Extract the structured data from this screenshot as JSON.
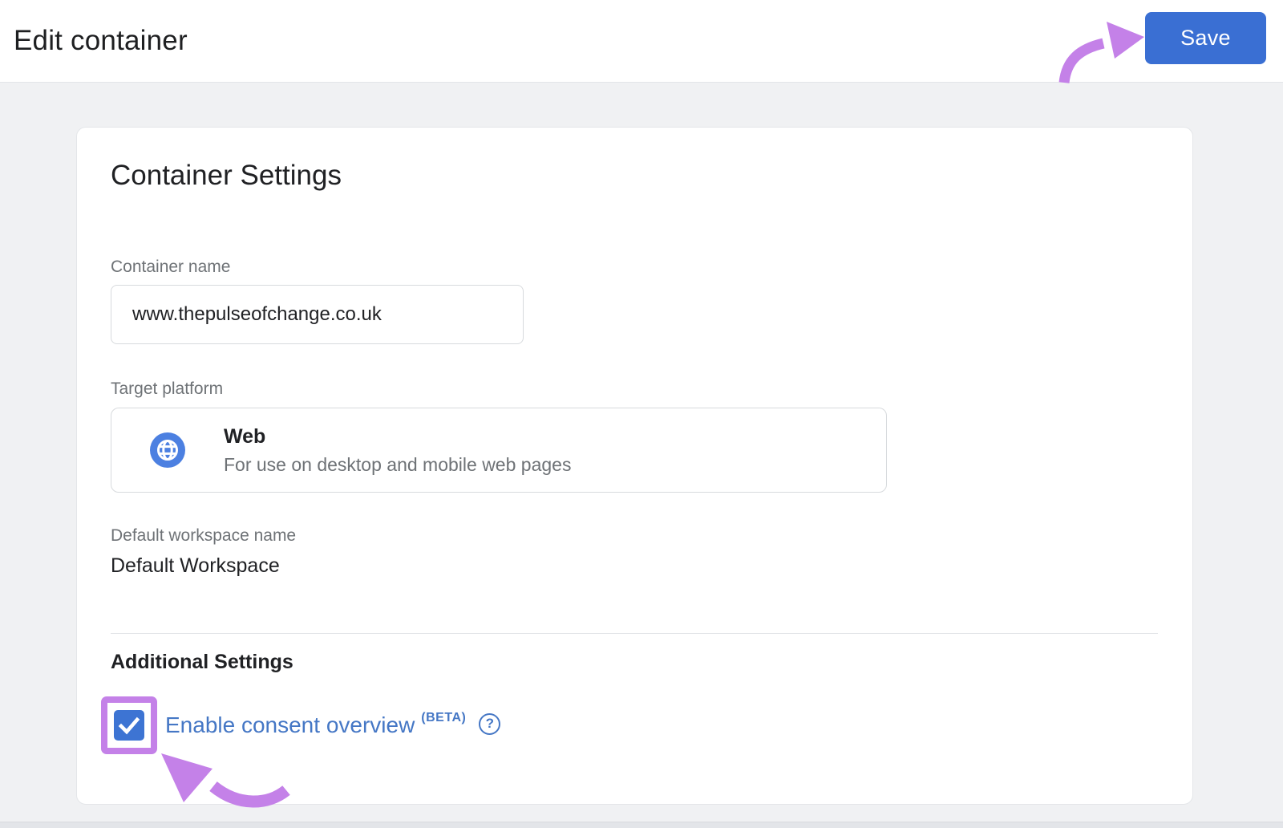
{
  "header": {
    "title": "Edit container",
    "save_button": "Save"
  },
  "container_settings": {
    "title": "Container Settings",
    "container_name": {
      "label": "Container name",
      "value": "www.thepulseofchange.co.uk"
    },
    "target_platform": {
      "label": "Target platform",
      "selected": {
        "name": "Web",
        "description": "For use on desktop and mobile web pages",
        "icon": "globe-icon"
      }
    },
    "default_workspace": {
      "label": "Default workspace name",
      "value": "Default Workspace"
    },
    "additional_settings": {
      "title": "Additional Settings",
      "consent_overview": {
        "checked": true,
        "label": "Enable consent overview",
        "badge": "(BETA)",
        "help_icon_glyph": "?"
      }
    }
  },
  "annotations": {
    "color": "#c481e8",
    "arrow_to_save_button": true,
    "box_and_arrow_on_consent_checkbox": true
  },
  "colors": {
    "primary_blue": "#3a6fd3",
    "checkbox_blue": "#3d74d3",
    "link_blue": "#4577c5",
    "globe_blue": "#4c80e1",
    "annotation_purple": "#c481e8",
    "page_background": "#f0f1f3"
  }
}
